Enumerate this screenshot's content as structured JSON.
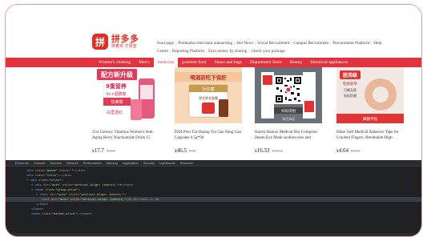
{
  "header": {
    "logo_cn": "拼多多",
    "logo_tagline": "拼着买·才便宜",
    "links": [
      "front page",
      "Pinduoduo merchant onboarding",
      "Hot News",
      "Social Recruitment",
      "Campus Recruitment",
      "Procurement Platform",
      "Help Centre",
      "Reporting Platform",
      "Earn money by sharing",
      "Check your package"
    ]
  },
  "nav": {
    "items": [
      "Women's clothing",
      "Men's",
      "medicine",
      "gourmet food",
      "Shoes and bags",
      "Department Store",
      "Beauty",
      "Electrical appliances"
    ],
    "active_index": 2
  },
  "products": [
    {
      "title": "21st Century Vitamins Women's Anti-Aging Berry Niacinamide Drink 15",
      "price_currency": "¥",
      "price": "17.7",
      "old_price": "¥ 99.9",
      "image_text": [
        "配方新升级",
        "9重营养",
        "Vc+烟酰胺",
        "饮美莓",
        "白里透红"
      ]
    },
    {
      "title": "PZH Pien Tze Huang Yin Gan Pang Gan Capsules 0.5g*90",
      "price_currency": "¥",
      "price": "46.5",
      "old_price": "¥ 58",
      "image_text": [
        "喝酒前吃下保肝",
        "片仔癀",
        "银甘胖甘胶囊"
      ]
    },
    {
      "title": "Haishi Hainuo Medical Hot Compress Steam Eye Mask soothes eyes and",
      "price_currency": "¥",
      "price": "16.33",
      "old_price": "¥ 119.6",
      "image_text": [
        "扫码识别",
        "海氏海诺"
      ]
    },
    {
      "title": "Hiker Soft Medical Adhesive Tape for Cracked Fingers, Breathable High-",
      "price_currency": "¥",
      "price": "4.64",
      "old_price": "¥ 19.9",
      "image_text": [
        "医用级",
        "软质胶带",
        "可撕无痕",
        "轻松防磨",
        "脚部手指"
      ]
    }
  ],
  "devtools": {
    "tabs": [
      "Elements",
      "Console",
      "Sources",
      "Network",
      "Performance",
      "Memory",
      "Application",
      "Security",
      "Lighthouse",
      "Recorder"
    ],
    "active_tab": 0,
    "lines": [
      {
        "indent": 2,
        "html": "<span class=\"t-tag\">&lt;div</span> <span class=\"t-attr\">class</span>=<span class=\"t-val\">\"goods\"</span> <span class=\"t-attr\">style</span>=<span class=\"t-val\">\"\"</span>&gt;&lt;/div&gt;"
      },
      {
        "indent": 2,
        "html": "<span class=\"t-tag\">&lt;div</span> <span class=\"t-attr\">class</span>=<span class=\"t-val\">\"title\"</span>&gt;…&lt;/div&gt;"
      },
      {
        "indent": 2,
        "html": "▾ <span class=\"t-tag\">&lt;div</span> <span class=\"t-attr\">class</span>=<span class=\"t-val\">\"price\"</span>&gt;"
      },
      {
        "indent": 3,
        "html": "▾ <span class=\"t-tag\">&lt;div</span> <span class=\"t-attr\">dir</span>=<span class=\"t-val\">\"auto\"</span> <span class=\"t-attr\">style</span>=<span class=\"t-val\">\"vertical-align: inherit;\"</span>&gt;¥&lt;/font&gt;"
      },
      {
        "indent": 3,
        "html": "▾ <span class=\"t-tag\">&lt;span</span> <span class=\"t-attr\">class</span>=<span class=\"t-val\">\"group-price\"</span>&gt;"
      },
      {
        "indent": 4,
        "html": "▾ <span class=\"t-tag\">&lt;font</span> <span class=\"t-attr\">dir</span>=<span class=\"t-val\">\"auto\"</span> <span class=\"t-attr\">style</span>=<span class=\"t-val\">\"vertical-align: inherit;\"</span>&gt;"
      },
      {
        "indent": 5,
        "html": "<span class=\"t-tag\">&lt;font</span> <span class=\"t-attr\">dir</span>=<span class=\"t-val\">\"auto\"</span> <span class=\"t-attr\">style</span>=<span class=\"t-val\">\"vertical-align: inherit;\"</span>&gt;16.33&lt;/font&gt; == $0",
        "selected": true
      },
      {
        "indent": 4,
        "html": "&lt;/font&gt;"
      },
      {
        "indent": 3,
        "html": "&lt;/span&gt;"
      },
      {
        "indent": 3,
        "html": "<span class=\"t-tag\">&lt;span</span> <span class=\"t-attr\">class</span>=<span class=\"t-val\">\"market-price\"</span>&gt;…&lt;/span&gt;"
      }
    ]
  }
}
